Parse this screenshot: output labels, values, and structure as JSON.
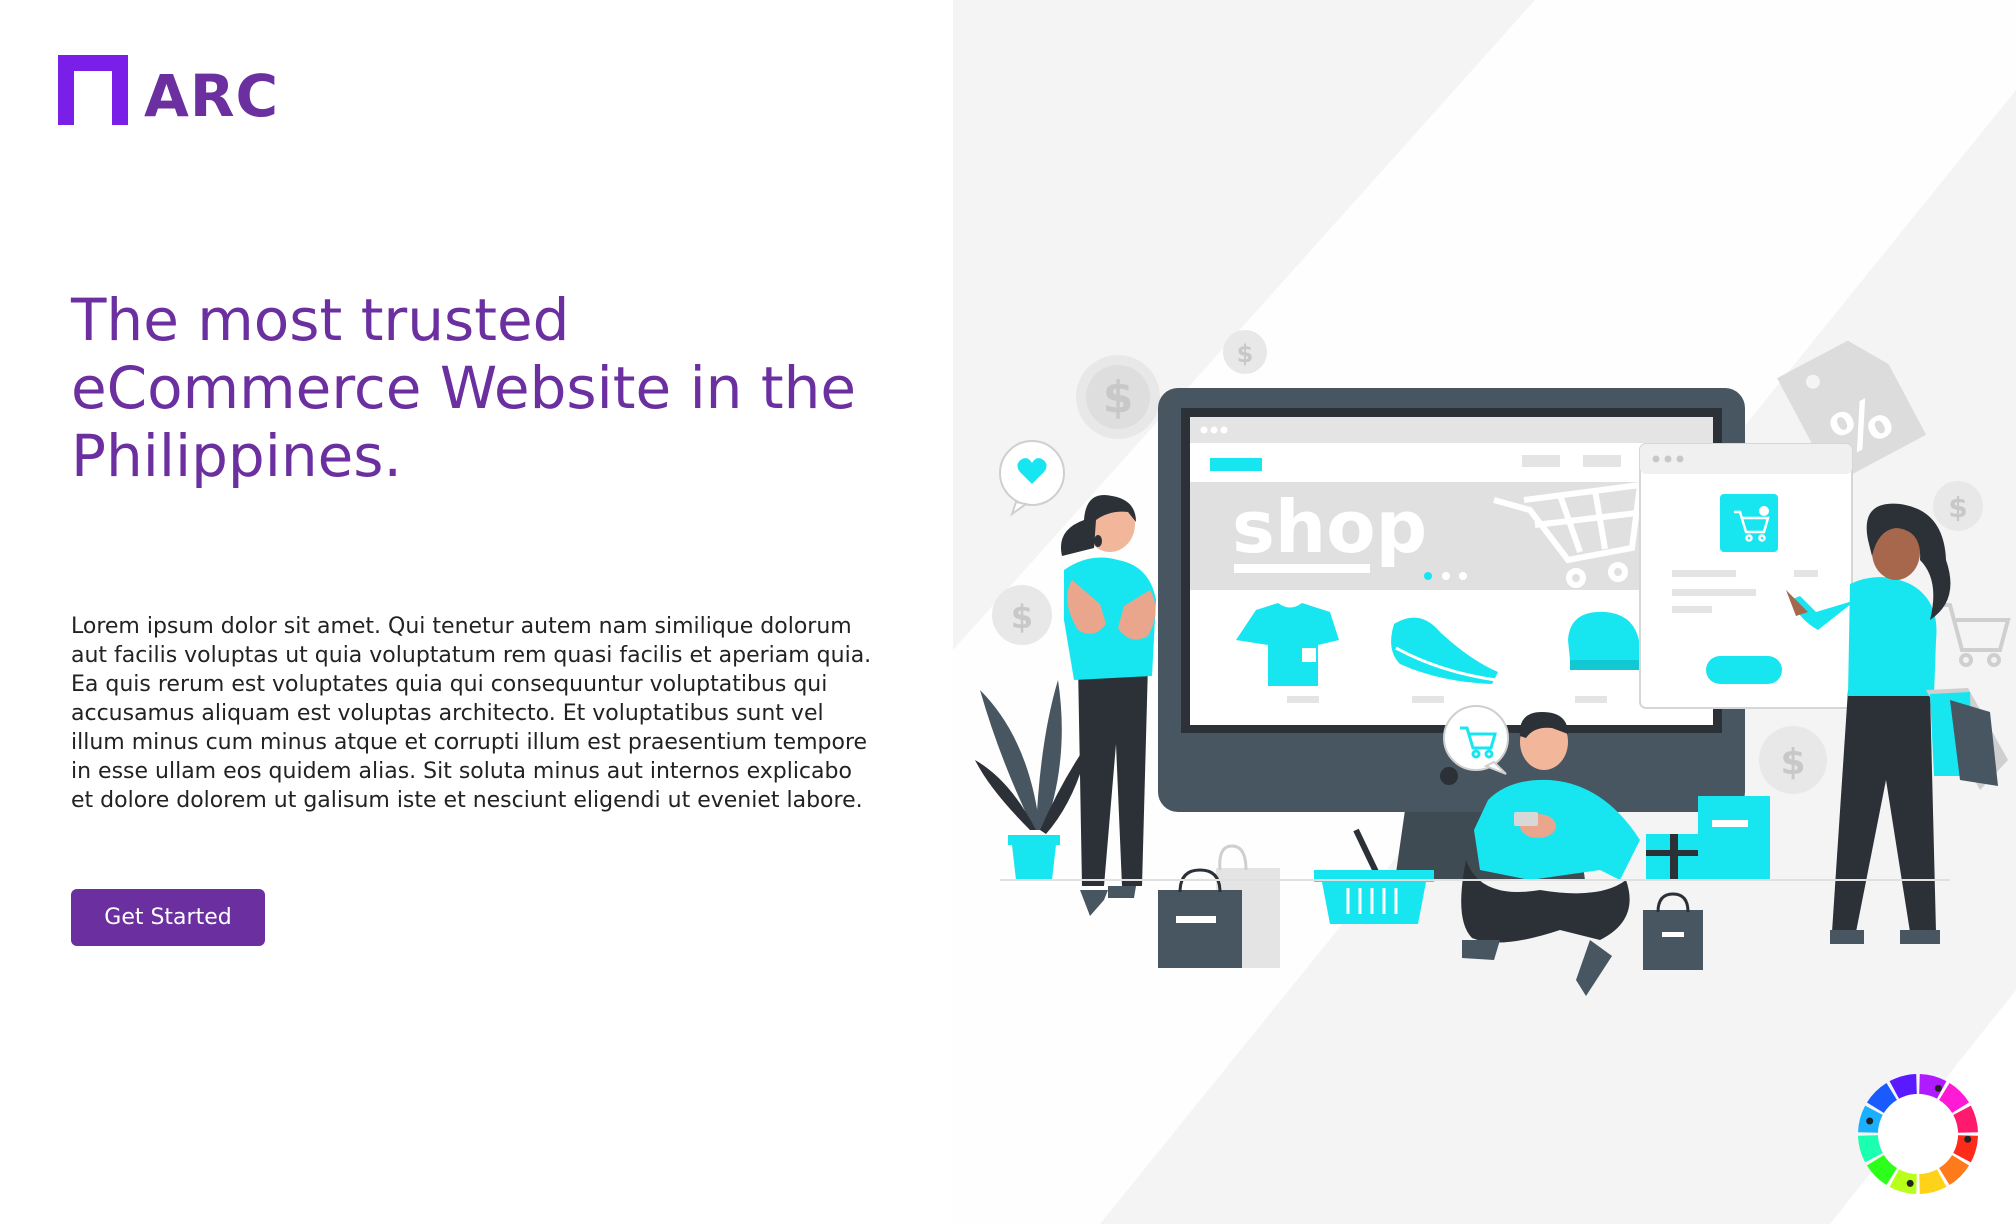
{
  "brand": {
    "name": "ARC",
    "color": "#6b2fa0",
    "accent": "#7a1fe8"
  },
  "hero": {
    "headline": "The most trusted eCommerce Website in the Philippines.",
    "body": "Lorem ipsum dolor sit amet. Qui tenetur autem nam similique dolorum aut facilis voluptas ut quia voluptatum rem quasi facilis et aperiam quia. Ea quis rerum est voluptates quia qui consequuntur voluptatibus qui accusamus aliquam est voluptas architecto. Et voluptatibus sunt vel illum minus cum minus atque et corrupti illum est praesentium tempore in esse ullam eos quidem alias. Sit soluta minus aut internos explicabo et dolore dolorem ut galisum iste et nesciunt eligendi ut eveniet labore.",
    "cta_label": "Get Started"
  },
  "illustration": {
    "shop_label": "shop",
    "percent_tag": "%",
    "coin_symbol": "$",
    "colors": {
      "cyan": "#17e6f0",
      "dark": "#2b3137",
      "monitor": "#475660",
      "light_gray": "#e4e4e4"
    }
  },
  "icons": [
    "logo-icon",
    "heart-icon",
    "cart-icon",
    "dollar-coin-icon",
    "percent-tag-icon",
    "color-wheel-icon"
  ]
}
